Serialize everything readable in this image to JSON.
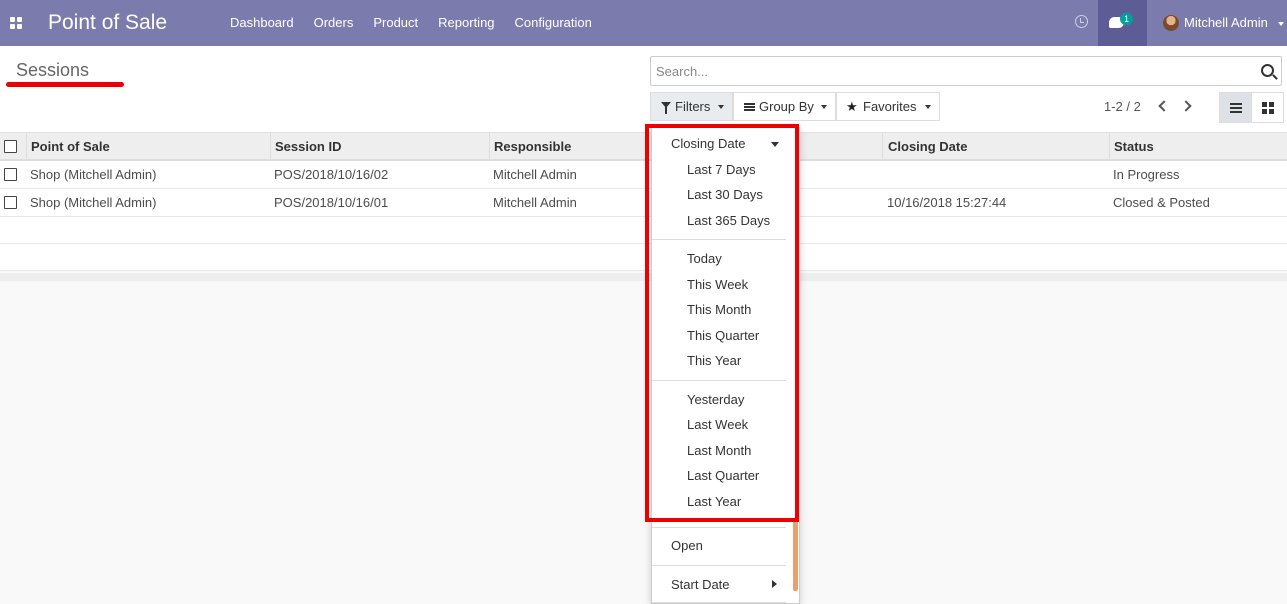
{
  "app": {
    "title": "Point of Sale"
  },
  "nav": {
    "items": [
      {
        "label": "Dashboard"
      },
      {
        "label": "Orders"
      },
      {
        "label": "Product"
      },
      {
        "label": "Reporting"
      },
      {
        "label": "Configuration"
      }
    ],
    "chat_badge": "1",
    "user_name": "Mitchell Admin"
  },
  "page": {
    "title": "Sessions"
  },
  "search": {
    "placeholder": "Search..."
  },
  "toolbar": {
    "filters_label": "Filters",
    "groupby_label": "Group By",
    "favorites_label": "Favorites"
  },
  "pager": {
    "value": "1-2 / 2"
  },
  "table": {
    "columns": [
      "Point of Sale",
      "Session ID",
      "Responsible",
      "Closing Date",
      "Status"
    ],
    "rows": [
      {
        "pos": "Shop (Mitchell Admin)",
        "session_id": "POS/2018/10/16/02",
        "responsible": "Mitchell Admin",
        "closing_date": "",
        "status": "In Progress"
      },
      {
        "pos": "Shop (Mitchell Admin)",
        "session_id": "POS/2018/10/16/01",
        "responsible": "Mitchell Admin",
        "closing_date": "10/16/2018 15:27:44",
        "status": "Closed & Posted"
      }
    ]
  },
  "filters_dropdown": {
    "group_header": "Closing Date",
    "group_range": [
      "Last 7 Days",
      "Last 30 Days",
      "Last 365 Days"
    ],
    "group_current": [
      "Today",
      "This Week",
      "This Month",
      "This Quarter",
      "This Year"
    ],
    "group_previous": [
      "Yesterday",
      "Last Week",
      "Last Month",
      "Last Quarter",
      "Last Year"
    ],
    "open_label": "Open",
    "start_date_label": "Start Date"
  },
  "colors": {
    "navbar": "#7c7bad",
    "chat_bg": "#5e5c94",
    "badge": "#00a09d",
    "annotation": "#ee0000"
  }
}
